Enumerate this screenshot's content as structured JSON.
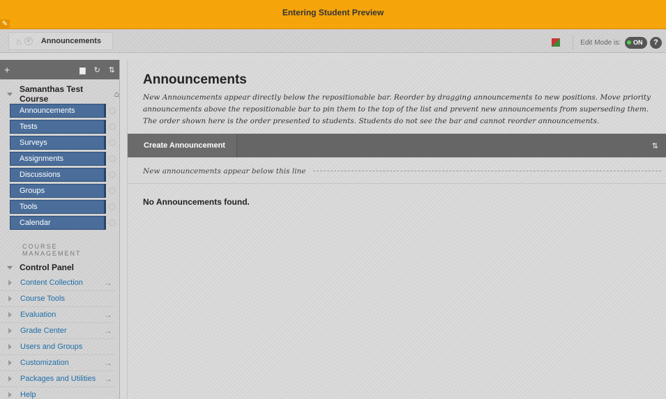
{
  "preview_bar": {
    "title": "Entering Student Preview"
  },
  "breadcrumb": {
    "current": "Announcements"
  },
  "edit_mode": {
    "label": "Edit Mode is:",
    "state": "ON",
    "help": "?"
  },
  "sidebar": {
    "course_name": "Samanthas Test Course",
    "items": [
      {
        "label": "Announcements"
      },
      {
        "label": "Tests"
      },
      {
        "label": "Surveys"
      },
      {
        "label": "Assignments"
      },
      {
        "label": "Discussions"
      },
      {
        "label": "Groups"
      },
      {
        "label": "Tools"
      },
      {
        "label": "Calendar"
      }
    ],
    "course_management_heading": "COURSE MANAGEMENT",
    "control_panel": {
      "title": "Control Panel",
      "items": [
        {
          "label": "Content Collection",
          "arrow": "→"
        },
        {
          "label": "Course Tools",
          "arrow": ""
        },
        {
          "label": "Evaluation",
          "arrow": "→"
        },
        {
          "label": "Grade Center",
          "arrow": "→"
        },
        {
          "label": "Users and Groups",
          "arrow": ""
        },
        {
          "label": "Customization",
          "arrow": "→"
        },
        {
          "label": "Packages and Utilities",
          "arrow": "→"
        },
        {
          "label": "Help",
          "arrow": ""
        }
      ]
    }
  },
  "main": {
    "title": "Announcements",
    "description": "New Announcements appear directly below the repositionable bar. Reorder by dragging announcements to new positions. Move priority announcements above the repositionable bar to pin them to the top of the list and prevent new announcements from superseding them. The order shown here is the order presented to students. Students do not see the bar and cannot reorder announcements.",
    "create_button": "Create Announcement",
    "repositionable_text": "New announcements appear below this line",
    "empty_message": "No Announcements found."
  }
}
